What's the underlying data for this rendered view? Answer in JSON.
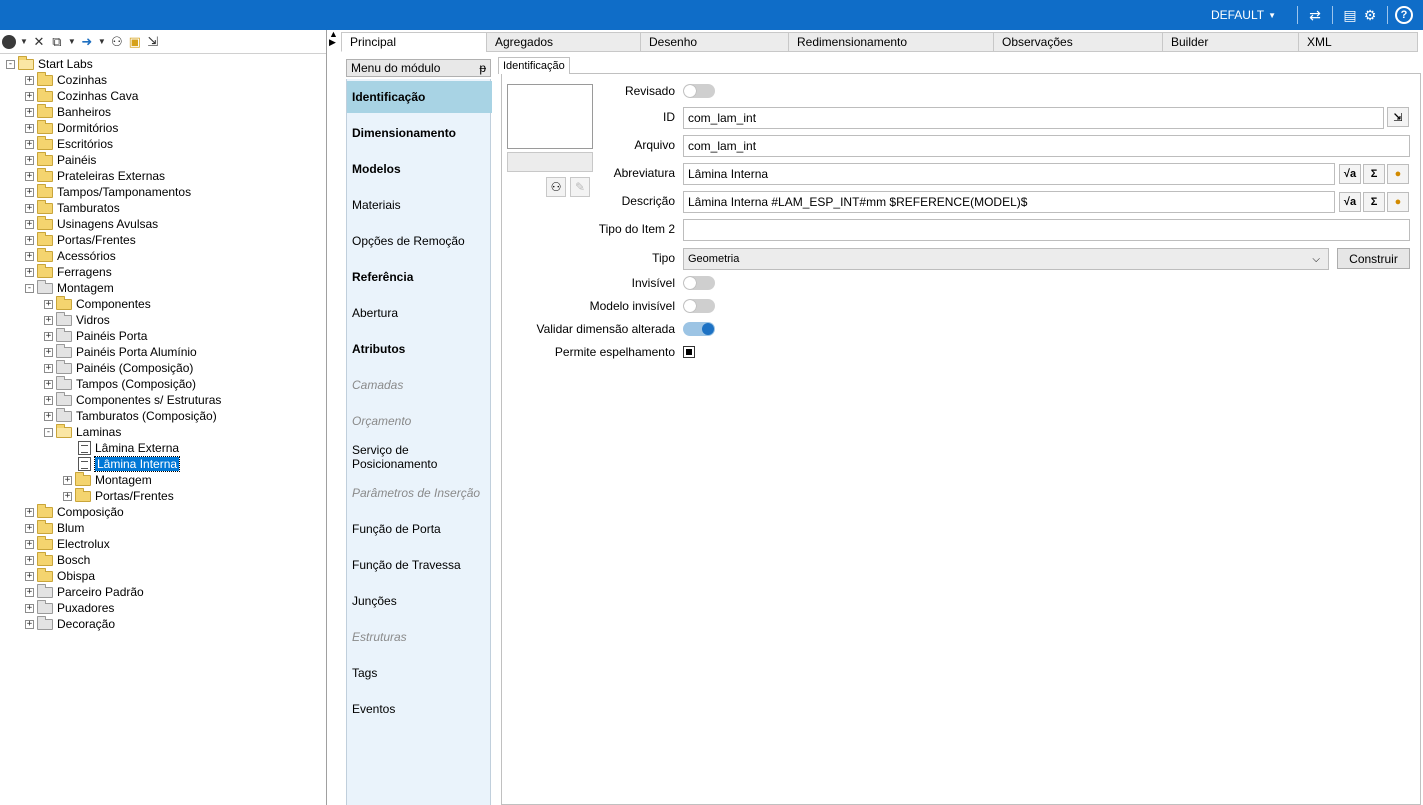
{
  "topbar": {
    "profile": "DEFAULT",
    "icons": [
      "sync-icon",
      "layout-icon",
      "settings-icon",
      "help-icon"
    ]
  },
  "left_toolbar": {
    "icons": [
      "globe-icon",
      "close-icon",
      "copy-icon",
      "down-arrow-icon",
      "binoculars-icon",
      "folder-refresh-icon",
      "tree-link-icon"
    ]
  },
  "tree": [
    {
      "label": "Start Labs",
      "depth": 0,
      "expander": "-",
      "icon": "folder-open"
    },
    {
      "label": "Cozinhas",
      "depth": 1,
      "expander": "+",
      "icon": "folder"
    },
    {
      "label": "Cozinhas Cava",
      "depth": 1,
      "expander": "+",
      "icon": "folder"
    },
    {
      "label": "Banheiros",
      "depth": 1,
      "expander": "+",
      "icon": "folder"
    },
    {
      "label": "Dormitórios",
      "depth": 1,
      "expander": "+",
      "icon": "folder"
    },
    {
      "label": "Escritórios",
      "depth": 1,
      "expander": "+",
      "icon": "folder"
    },
    {
      "label": "Painéis",
      "depth": 1,
      "expander": "+",
      "icon": "folder"
    },
    {
      "label": "Prateleiras Externas",
      "depth": 1,
      "expander": "+",
      "icon": "folder"
    },
    {
      "label": "Tampos/Tamponamentos",
      "depth": 1,
      "expander": "+",
      "icon": "folder"
    },
    {
      "label": "Tamburatos",
      "depth": 1,
      "expander": "+",
      "icon": "folder"
    },
    {
      "label": "Usinagens Avulsas",
      "depth": 1,
      "expander": "+",
      "icon": "folder"
    },
    {
      "label": "Portas/Frentes",
      "depth": 1,
      "expander": "+",
      "icon": "folder"
    },
    {
      "label": "Acessórios",
      "depth": 1,
      "expander": "+",
      "icon": "folder"
    },
    {
      "label": "Ferragens",
      "depth": 1,
      "expander": "+",
      "icon": "folder"
    },
    {
      "label": "Montagem",
      "depth": 1,
      "expander": "-",
      "icon": "folder-gray-open"
    },
    {
      "label": "Componentes",
      "depth": 2,
      "expander": "+",
      "icon": "folder"
    },
    {
      "label": "Vidros",
      "depth": 2,
      "expander": "+",
      "icon": "folder-gray"
    },
    {
      "label": "Painéis Porta",
      "depth": 2,
      "expander": "+",
      "icon": "folder-gray"
    },
    {
      "label": "Painéis Porta Alumínio",
      "depth": 2,
      "expander": "+",
      "icon": "folder-gray"
    },
    {
      "label": "Painéis (Composição)",
      "depth": 2,
      "expander": "+",
      "icon": "folder-gray"
    },
    {
      "label": "Tampos (Composição)",
      "depth": 2,
      "expander": "+",
      "icon": "folder-gray"
    },
    {
      "label": "Componentes s/ Estruturas",
      "depth": 2,
      "expander": "+",
      "icon": "folder-gray"
    },
    {
      "label": "Tamburatos (Composição)",
      "depth": 2,
      "expander": "+",
      "icon": "folder-gray"
    },
    {
      "label": "Laminas",
      "depth": 2,
      "expander": "-",
      "icon": "folder-open"
    },
    {
      "label": "Lâmina Externa",
      "depth": 3,
      "expander": "",
      "icon": "doc"
    },
    {
      "label": "Lâmina Interna",
      "depth": 3,
      "expander": "",
      "icon": "doc",
      "selected": true
    },
    {
      "label": "Montagem",
      "depth": 3,
      "expander": "+",
      "icon": "folder",
      "pad": true
    },
    {
      "label": "Portas/Frentes",
      "depth": 3,
      "expander": "+",
      "icon": "folder",
      "pad": true
    },
    {
      "label": "Composição",
      "depth": 1,
      "expander": "+",
      "icon": "folder"
    },
    {
      "label": "Blum",
      "depth": 1,
      "expander": "+",
      "icon": "folder"
    },
    {
      "label": "Electrolux",
      "depth": 1,
      "expander": "+",
      "icon": "folder"
    },
    {
      "label": "Bosch",
      "depth": 1,
      "expander": "+",
      "icon": "folder"
    },
    {
      "label": "Obispa",
      "depth": 1,
      "expander": "+",
      "icon": "folder"
    },
    {
      "label": "Parceiro Padrão",
      "depth": 1,
      "expander": "+",
      "icon": "folder-gray"
    },
    {
      "label": "Puxadores",
      "depth": 1,
      "expander": "+",
      "icon": "folder-gray"
    },
    {
      "label": "Decoração",
      "depth": 1,
      "expander": "+",
      "icon": "folder-gray"
    }
  ],
  "tabs": [
    {
      "label": "Principal",
      "active": true
    },
    {
      "label": "Agregados"
    },
    {
      "label": "Desenho"
    },
    {
      "label": "Redimensionamento"
    },
    {
      "label": "Observações"
    },
    {
      "label": "Builder"
    },
    {
      "label": "XML"
    }
  ],
  "module_menu": {
    "title": "Menu do módulo",
    "pin": "ᵽ",
    "items": [
      {
        "label": "Identificação",
        "style": "bold",
        "active": true
      },
      {
        "label": "Dimensionamento",
        "style": "bold"
      },
      {
        "label": "Modelos",
        "style": "bold"
      },
      {
        "label": "Materiais",
        "style": "normal"
      },
      {
        "label": "Opções de Remoção",
        "style": "normal"
      },
      {
        "label": "Referência",
        "style": "bold"
      },
      {
        "label": "Abertura",
        "style": "normal"
      },
      {
        "label": "Atributos",
        "style": "bold"
      },
      {
        "label": "Camadas",
        "style": "disabled"
      },
      {
        "label": "Orçamento",
        "style": "disabled"
      },
      {
        "label": "Serviço de Posicionamento",
        "style": "normal"
      },
      {
        "label": "Parâmetros de Inserção",
        "style": "disabled"
      },
      {
        "label": "Função de Porta",
        "style": "normal"
      },
      {
        "label": "Função de Travessa",
        "style": "normal"
      },
      {
        "label": "Junções",
        "style": "normal"
      },
      {
        "label": "Estruturas",
        "style": "disabled"
      },
      {
        "label": "Tags",
        "style": "normal"
      },
      {
        "label": "Eventos",
        "style": "normal"
      }
    ]
  },
  "identificacao": {
    "subtab": "Identificação",
    "revisado": {
      "label": "Revisado",
      "on": false
    },
    "id": {
      "label": "ID",
      "value": "com_lam_int"
    },
    "arquivo": {
      "label": "Arquivo",
      "value": "com_lam_int"
    },
    "abreviatura": {
      "label": "Abreviatura",
      "value": "Lâmina Interna"
    },
    "descricao": {
      "label": "Descrição",
      "value": "Lâmina Interna #LAM_ESP_INT#mm $REFERENCE(MODEL)$"
    },
    "tipo_item2": {
      "label": "Tipo do Item 2",
      "value": ""
    },
    "tipo": {
      "label": "Tipo",
      "value": "Geometria",
      "button": "Construir"
    },
    "invisivel": {
      "label": "Invisível",
      "on": false
    },
    "modelo_invisivel": {
      "label": "Modelo invisível",
      "on": false
    },
    "validar": {
      "label": "Validar dimensão alterada",
      "on": true
    },
    "espelhamento": {
      "label": "Permite espelhamento",
      "checked": true
    },
    "formula_btn": "√a",
    "sigma_btn": "Σ"
  },
  "colors": {
    "topbar": "#0f6dc8",
    "menu_bg": "#eaf3fb",
    "menu_active": "#a8d3e4",
    "selection": "#0078d7"
  }
}
